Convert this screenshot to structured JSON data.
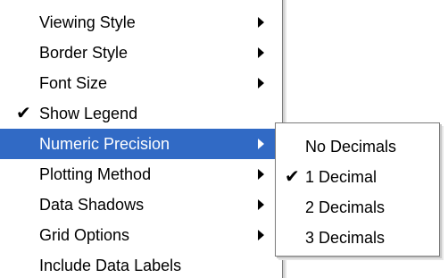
{
  "menu": {
    "items": [
      {
        "label": "Viewing Style",
        "has_submenu": true,
        "checked": false,
        "selected": false
      },
      {
        "label": "Border Style",
        "has_submenu": true,
        "checked": false,
        "selected": false
      },
      {
        "label": "Font Size",
        "has_submenu": true,
        "checked": false,
        "selected": false
      },
      {
        "label": "Show Legend",
        "has_submenu": false,
        "checked": true,
        "selected": false
      },
      {
        "label": "Numeric Precision",
        "has_submenu": true,
        "checked": false,
        "selected": true
      },
      {
        "label": "Plotting Method",
        "has_submenu": true,
        "checked": false,
        "selected": false
      },
      {
        "label": "Data Shadows",
        "has_submenu": true,
        "checked": false,
        "selected": false
      },
      {
        "label": "Grid Options",
        "has_submenu": true,
        "checked": false,
        "selected": false
      },
      {
        "label": "Include Data Labels",
        "has_submenu": false,
        "checked": false,
        "selected": false
      }
    ]
  },
  "submenu": {
    "items": [
      {
        "label": "No Decimals",
        "checked": false
      },
      {
        "label": "1 Decimal",
        "checked": true
      },
      {
        "label": "2 Decimals",
        "checked": false
      },
      {
        "label": "3 Decimals",
        "checked": false
      }
    ]
  },
  "icons": {
    "check": "checkmark-icon",
    "submenu_arrow": "submenu-arrow-icon"
  },
  "colors": {
    "selection": "#316ac5",
    "selection_text": "#ffffff",
    "border": "#7a7a7a"
  }
}
